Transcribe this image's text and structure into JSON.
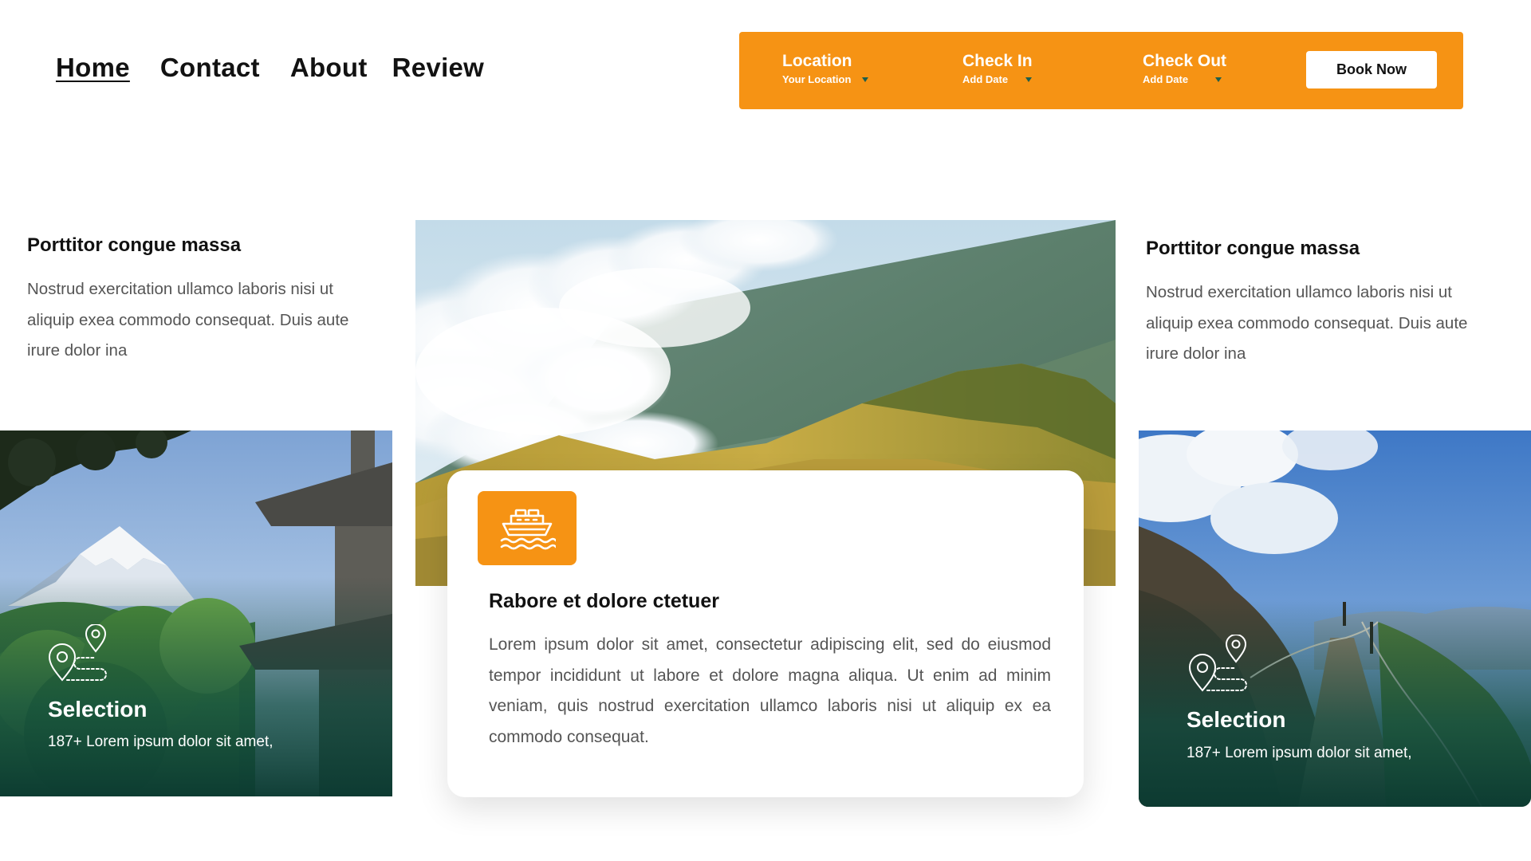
{
  "nav": {
    "items": [
      {
        "label": "Home",
        "active": true
      },
      {
        "label": "Contact"
      },
      {
        "label": "About"
      },
      {
        "label": "Review"
      }
    ]
  },
  "booking": {
    "accent_color": "#f69314",
    "caret_color": "#1d5e4c",
    "fields": [
      {
        "label": "Location",
        "value": "Your Location"
      },
      {
        "label": "Check In",
        "value": "Add Date"
      },
      {
        "label": "Check Out",
        "value": "Add Date"
      }
    ],
    "button_label": "Book Now"
  },
  "left_text": {
    "heading": "Porttitor congue massa",
    "body": "Nostrud exercitation ullamco laboris nisi ut aliquip exea commodo consequat. Duis aute irure dolor ina"
  },
  "right_text": {
    "heading": "Porttitor congue massa",
    "body": "Nostrud exercitation ullamco laboris nisi ut aliquip exea commodo consequat. Duis aute irure dolor ina"
  },
  "center_card": {
    "icon": "ship-icon",
    "title": "Rabore et dolore ctetuer",
    "body": "Lorem ipsum dolor sit amet, consectetur adipiscing elit, sed do eiusmod tempor incididunt ut labore et dolore magna aliqua. Ut enim ad minim veniam, quis nostrud exercitation ullamco laboris nisi ut aliquip ex ea commodo consequat."
  },
  "left_card": {
    "icon": "map-route-icon",
    "title": "Selection",
    "subtitle": "187+ Lorem ipsum dolor sit amet,"
  },
  "right_card": {
    "icon": "map-route-icon",
    "title": "Selection",
    "subtitle": "187+ Lorem ipsum dolor sit amet,"
  }
}
